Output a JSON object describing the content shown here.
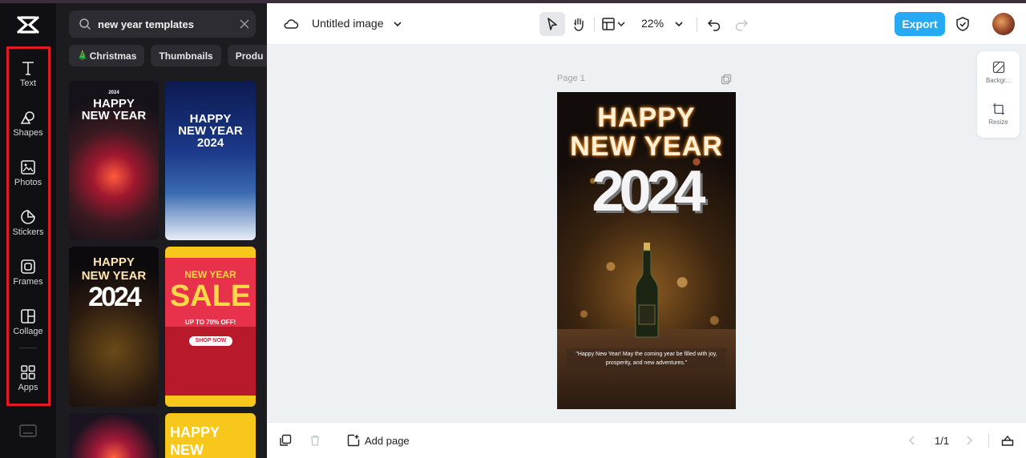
{
  "rail": {
    "items": [
      {
        "label": "Text",
        "icon": "text-icon"
      },
      {
        "label": "Shapes",
        "icon": "shapes-icon"
      },
      {
        "label": "Photos",
        "icon": "photos-icon"
      },
      {
        "label": "Stickers",
        "icon": "stickers-icon"
      },
      {
        "label": "Frames",
        "icon": "frames-icon"
      },
      {
        "label": "Collage",
        "icon": "collage-icon"
      },
      {
        "label": "Apps",
        "icon": "apps-icon"
      }
    ],
    "highlight_color": "#e01b24"
  },
  "panel": {
    "search": {
      "value": "new year templates"
    },
    "chips": [
      {
        "label": "Christmas",
        "emoji": "🎄"
      },
      {
        "label": "Thumbnails"
      },
      {
        "label": "Produ"
      }
    ],
    "templates": {
      "t1": {
        "line1": "2024",
        "line2": "HAPPY",
        "line3": "NEW YEAR"
      },
      "t2": {
        "line1": "HAPPY",
        "line2": "NEW YEAR",
        "line3": "2024"
      },
      "t3": {
        "line1": "HAPPY",
        "line2": "NEW YEAR",
        "line3": "2024"
      },
      "t4": {
        "line1": "NEW YEAR",
        "line2": "SALE",
        "line3": "UP TO 70% OFF!",
        "line4": "SHOP NOW"
      },
      "t6": {
        "line1": "HAPPY",
        "line2": "NEW"
      }
    }
  },
  "topbar": {
    "title": "Untitled image",
    "zoom": "22%",
    "export_label": "Export",
    "accent": "#27a9f4"
  },
  "canvas": {
    "page_label": "Page 1",
    "artboard": {
      "title_line1": "HAPPY",
      "title_line2": "NEW YEAR",
      "year": "2024",
      "message": "\"Happy New Year! May the coming year be filled with joy, prosperity, and new adventures.\""
    },
    "side_panel": [
      {
        "label": "Backgr..."
      },
      {
        "label": "Resize"
      }
    ]
  },
  "bottombar": {
    "add_page_label": "Add page",
    "pager": "1/1"
  }
}
